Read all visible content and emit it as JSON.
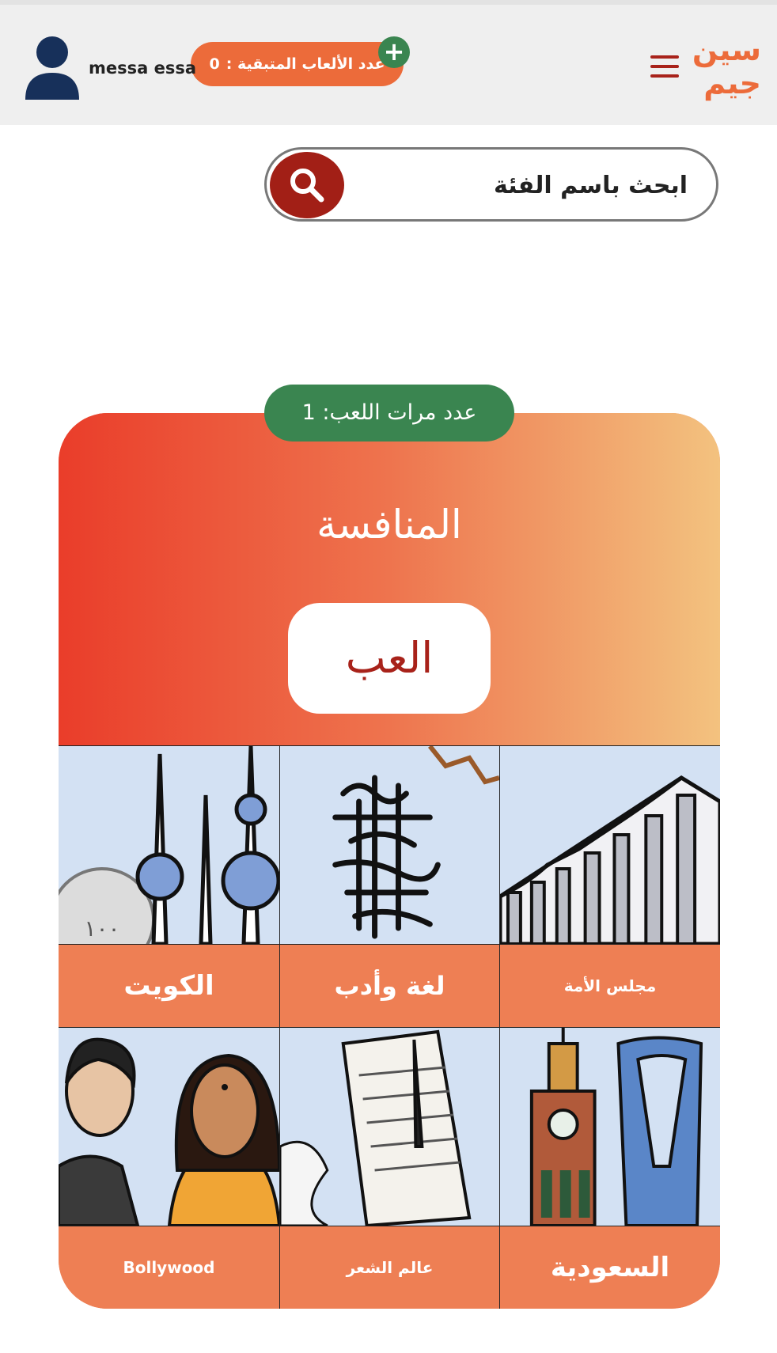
{
  "header": {
    "brand_line1": "سين",
    "brand_line2": "جيم",
    "remaining_games_label": "عدد الألعاب المتبقية :",
    "remaining_games_value": "0",
    "add_symbol": "+",
    "username": "messa essa"
  },
  "search": {
    "placeholder": "ابحث باسم الفئة"
  },
  "featured": {
    "play_count_label": "عدد مرات اللعب: 1",
    "title": "المنافسة",
    "play_button": "العب"
  },
  "categories": [
    {
      "label": "مجلس الأمة"
    },
    {
      "label": "لغة وأدب"
    },
    {
      "label": "الكويت"
    },
    {
      "label": "السعودية"
    },
    {
      "label": "عالم الشعر"
    },
    {
      "label": "Bollywood"
    }
  ],
  "colors": {
    "brand_orange": "#ec6b3a",
    "dark_red": "#a21f16",
    "green": "#3a8550",
    "tile_orange": "#ee7f54",
    "tile_bg": "#d3e1f3"
  },
  "icons": {
    "menu": "hamburger-icon",
    "search": "search-icon",
    "avatar": "user-avatar-icon",
    "add": "plus-icon"
  }
}
